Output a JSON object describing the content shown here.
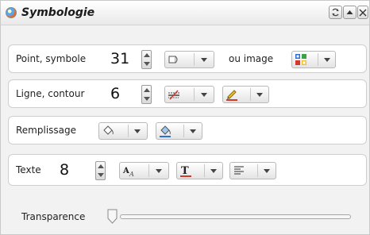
{
  "panel": {
    "title": "Symbologie",
    "controls": [
      "refresh-icon",
      "collapse-up-icon",
      "close-icon"
    ]
  },
  "point": {
    "label": "Point, symbole",
    "size": "31",
    "shape_icon": "symbol-shape-icon",
    "image_label": "ou image",
    "image_icon": "image-grid-icon"
  },
  "line": {
    "label": "Ligne, contour",
    "width": "6",
    "style_icon": "line-style-icon",
    "color_icon": "pencil-color-icon"
  },
  "fill": {
    "label": "Remplissage",
    "fill_icon": "paint-bucket-icon",
    "color_icon": "paint-bucket-color-icon"
  },
  "text": {
    "label": "Texte",
    "size": "8",
    "font_icon": "font-icon",
    "color_icon": "text-color-icon",
    "align_icon": "text-align-icon"
  },
  "transparency": {
    "label": "Transparence",
    "value": 0
  },
  "colors": {
    "accent_red": "#d23a2a",
    "accent_blue": "#2d6fd6",
    "accent_yellow": "#f1c232",
    "accent_green": "#3aa34a"
  }
}
